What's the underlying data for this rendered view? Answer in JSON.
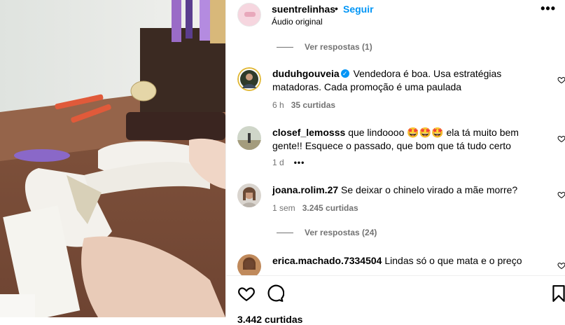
{
  "post": {
    "username": "suentrelinhas",
    "separator": "•",
    "follow_label": "Seguir",
    "audio_label": "Áudio original",
    "more_icon": "more-icon"
  },
  "replies_1": {
    "label": "Ver respostas (1)"
  },
  "comments": [
    {
      "username": "duduhgouveia",
      "verified": true,
      "text": "Vendedora é boa. Usa estratégias matadoras. Cada promoção é uma paulada",
      "time": "6 h",
      "likes": "35 curtidas"
    },
    {
      "username": "closef_lemosss",
      "text": "que lindoooo 🤩🤩🤩 ela tá muito bem gente!! Esquece o passado, que bom que tá tudo certo",
      "time": "1 d",
      "more": "•••"
    },
    {
      "username": "joana.rolim.27",
      "text": "Se deixar o chinelo virado a mãe morre?",
      "time": "1 sem",
      "likes": "3.245 curtidas"
    },
    {
      "username": "erica.machado.7334504",
      "text": "Lindas só o que mata e o preço"
    }
  ],
  "replies_2": {
    "label": "Ver respostas (24)"
  },
  "footer": {
    "likes_partial": "3.442 curtidas"
  },
  "colors": {
    "link_blue": "#0095f6",
    "secondary_text": "#737373"
  }
}
